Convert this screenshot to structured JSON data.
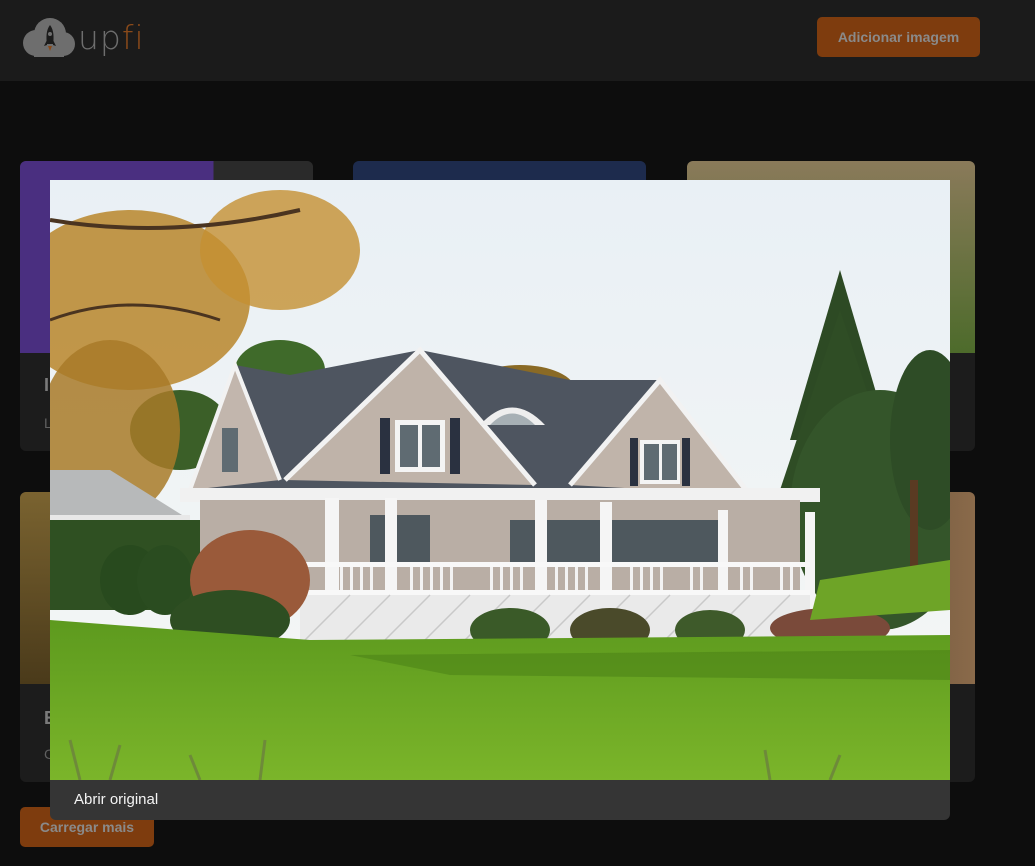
{
  "header": {
    "logo_up": "up",
    "logo_fi": "fi",
    "add_button_label": "Adicionar imagem"
  },
  "cards": [
    {
      "title_letter": "I",
      "desc_letter": "L",
      "thumb_color": "#4a2f80"
    },
    {
      "title_letter": "",
      "desc_letter": "",
      "thumb_color": "#1d2b4d"
    },
    {
      "title_letter": "",
      "desc_letter": "",
      "thumb_color": "#6b5a3a"
    },
    {
      "title_letter": "E",
      "desc_letter": "C",
      "thumb_color": "#6b5a2b"
    },
    {
      "title_letter": "",
      "desc_letter": "",
      "thumb_color": "#3a2e24"
    }
  ],
  "load_more_label": "Carregar mais",
  "modal": {
    "open_original_label": "Abrir original",
    "image_subject": "house-photo"
  },
  "colors": {
    "accent": "#dd6b20",
    "header_bg": "#1b1b1b",
    "page_bg": "#0d0d0d",
    "card_bg": "#1c1c1c",
    "modal_footer_bg": "#353535"
  }
}
